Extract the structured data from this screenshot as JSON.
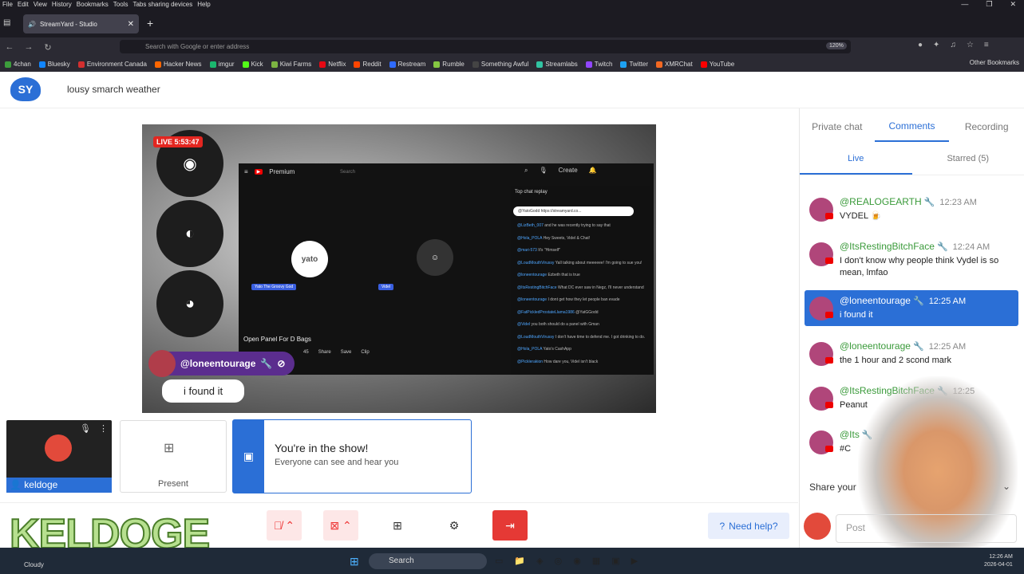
{
  "browser": {
    "menu": [
      "File",
      "Edit",
      "View",
      "History",
      "Bookmarks",
      "Tools",
      "Tabs sharing devices",
      "Help"
    ],
    "tab_title": "StreamYard - Studio",
    "url_placeholder": "Search with Google or enter address",
    "zoom": "120%",
    "bookmarks": [
      {
        "label": "4chan",
        "color": "#3c9d3c"
      },
      {
        "label": "Bluesky",
        "color": "#1185fe"
      },
      {
        "label": "Environment Canada",
        "color": "#d32f2f"
      },
      {
        "label": "Hacker News",
        "color": "#ff6600"
      },
      {
        "label": "imgur",
        "color": "#1bb76e"
      },
      {
        "label": "Kick",
        "color": "#53fc18"
      },
      {
        "label": "Kiwi Farms",
        "color": "#7cb342"
      },
      {
        "label": "Netflix",
        "color": "#e50914"
      },
      {
        "label": "Reddit",
        "color": "#ff4500"
      },
      {
        "label": "Restream",
        "color": "#2f6bff"
      },
      {
        "label": "Rumble",
        "color": "#85c742"
      },
      {
        "label": "Something Awful",
        "color": "#444444"
      },
      {
        "label": "Streamlabs",
        "color": "#31c3a2"
      },
      {
        "label": "Twitch",
        "color": "#9146ff"
      },
      {
        "label": "Twitter",
        "color": "#1da1f2"
      },
      {
        "label": "XMRChat",
        "color": "#f26822"
      },
      {
        "label": "YouTube",
        "color": "#ff0000"
      }
    ],
    "other_bookmarks": "Other Bookmarks"
  },
  "app": {
    "logo_text": "SY",
    "show_title": "lousy smarch weather"
  },
  "stage": {
    "live_badge": "LIVE 5:53:47",
    "inner": {
      "brand": "Premium",
      "search": "Search",
      "create": "Create",
      "guest1_name": "Yato The Groovy God",
      "guest1_avatar": "yato",
      "guest2_name": "Videl",
      "open_panel": "Open Panel For D Bags",
      "buttons": [
        "45",
        "Share",
        "Save",
        "Clip"
      ],
      "chat_header": "Top chat replay",
      "pinned": "@YatoGodd https://streamyard.co...",
      "chat_lines": [
        {
          "user": "@LizBeth_007",
          "text": "and he was recently trying to say that"
        },
        {
          "user": "@Hola_POLA",
          "text": "Hey Sweets, Videl & Chat!"
        },
        {
          "user": "@mari-573",
          "text": "It's \"Himself\""
        },
        {
          "user": "@LoudMouthVirussy",
          "text": "Yall talking about meeeeee! I'm going to sue you!"
        },
        {
          "user": "@loneentourage",
          "text": "Ezbeth that is true"
        },
        {
          "user": "@ItsRestingBitchFace",
          "text": "What DC ever saw in Negz, I'll never understand"
        },
        {
          "user": "@loneentourage",
          "text": "I dont get how they let people ban evade"
        },
        {
          "user": "@FatPickledProstateLlama1986",
          "text": "@YatGGodd"
        },
        {
          "user": "@Videl",
          "text": "you both should do a panel with Gman"
        },
        {
          "user": "@LoudMouthVirussy",
          "text": "I don't have time to defend me. I got drinking to do."
        },
        {
          "user": "@Hola_POLA",
          "text": "Yato's CashApp"
        },
        {
          "user": "@Picklerakion",
          "text": "How dare you, Videl isn't black"
        }
      ]
    },
    "namebar_user": "@loneentourage",
    "caption": "i found it"
  },
  "tiles": {
    "cam_name": "keldoge",
    "present_label": "Present",
    "show_title": "You're in the show!",
    "show_sub": "Everyone can see and hear you"
  },
  "controls": {
    "help_label": "Need help?"
  },
  "overlay_text": "KELDOGE",
  "panel": {
    "tabs": [
      "Private chat",
      "Comments",
      "Recording"
    ],
    "active_tab": "Comments",
    "subtabs": [
      "Live",
      "Starred (5)"
    ],
    "comments": [
      {
        "user": "@REALOGEARTH",
        "time": "12:23 AM",
        "text": "VYDEL 🍺",
        "highlight": false
      },
      {
        "user": "@ItsRestingBitchFace",
        "time": "12:24 AM",
        "text": "I don't know why people think Vydel is so mean, lmfao",
        "highlight": false
      },
      {
        "user": "@loneentourage",
        "time": "12:25 AM",
        "text": "i found it",
        "highlight": true
      },
      {
        "user": "@loneentourage",
        "time": "12:25 AM",
        "text": "the 1 hour and 2 scond mark",
        "highlight": false
      },
      {
        "user": "@ItsRestingBitchFace",
        "time": "12:25",
        "text": "Peanut",
        "highlight": false
      },
      {
        "user": "@Its",
        "time": "",
        "text": "#C",
        "highlight": false
      }
    ],
    "share_label": "Share your",
    "post_placeholder": "Post"
  },
  "taskbar": {
    "weather": "Cloudy",
    "search": "Search",
    "time": "12:26 AM",
    "date": "2026-04-01"
  }
}
